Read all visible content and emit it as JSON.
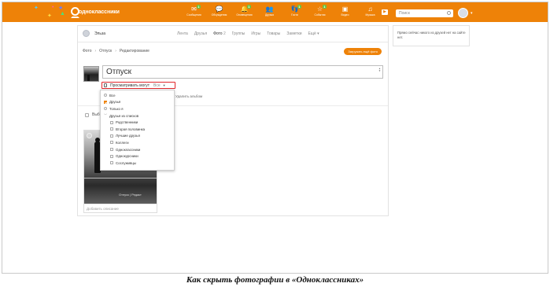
{
  "header": {
    "brand": "одноклассники",
    "accent_color": "#ee8208",
    "nav": [
      {
        "label": "Сообщения",
        "icon": "message-icon",
        "badge": "1"
      },
      {
        "label": "Обсуждения",
        "icon": "discussion-icon",
        "badge": ""
      },
      {
        "label": "Оповещения",
        "icon": "bell-icon",
        "badge": "1"
      },
      {
        "label": "Друзья",
        "icon": "friends-icon",
        "badge": ""
      },
      {
        "label": "Гости",
        "icon": "guests-icon",
        "badge": "1"
      },
      {
        "label": "События",
        "icon": "events-icon",
        "badge": "1"
      },
      {
        "label": "Видео",
        "icon": "video-icon",
        "badge": ""
      },
      {
        "label": "Музыка",
        "icon": "music-icon",
        "badge": ""
      }
    ],
    "search_placeholder": "Поиск"
  },
  "profile": {
    "name": "Эльза",
    "tabs": [
      "Лента",
      "Друзья",
      "Фото",
      "Группы",
      "Игры",
      "Товары",
      "Заметки",
      "Ещё"
    ],
    "active_tab_index": 2,
    "active_tab_count": "2"
  },
  "breadcrumbs": [
    "Фото",
    "Отпуск",
    "Редактирование"
  ],
  "upload_button": "Загрузить ещё фото",
  "album": {
    "title": "Отпуск",
    "privacy_label": "Просматривать могут",
    "privacy_value": "Все",
    "delete_label": "Удалить альбом",
    "select_all_label": "Выбр",
    "photo_watermark": "Отпуск | Редакт",
    "photo_description_placeholder": "Добавить описание"
  },
  "privacy_dropdown": {
    "items": [
      {
        "label": "Все",
        "control": "radio",
        "checked": false,
        "indent": false
      },
      {
        "label": "Друзья",
        "control": "checkbox",
        "checked": true,
        "indent": false
      },
      {
        "label": "Только я",
        "control": "radio",
        "checked": false,
        "indent": false
      },
      {
        "label": "Друзья из списков",
        "control": "chevron",
        "checked": false,
        "indent": false
      },
      {
        "label": "Родственники",
        "control": "checkbox",
        "checked": false,
        "indent": true
      },
      {
        "label": "Вторая половинка",
        "control": "checkbox",
        "checked": false,
        "indent": true
      },
      {
        "label": "Лучшие друзья",
        "control": "checkbox",
        "checked": false,
        "indent": true
      },
      {
        "label": "Коллеги",
        "control": "checkbox",
        "checked": false,
        "indent": true
      },
      {
        "label": "Одноклассники",
        "control": "checkbox",
        "checked": false,
        "indent": true
      },
      {
        "label": "Однокурсники",
        "control": "checkbox",
        "checked": false,
        "indent": true
      },
      {
        "label": "Сослуживцы",
        "control": "checkbox",
        "checked": false,
        "indent": true
      }
    ]
  },
  "sidebar": {
    "online_text": "Прямо сейчас никого из друзей нет на сайте нет."
  },
  "caption": "Как скрыть фотографии в «Одноклассниках»"
}
